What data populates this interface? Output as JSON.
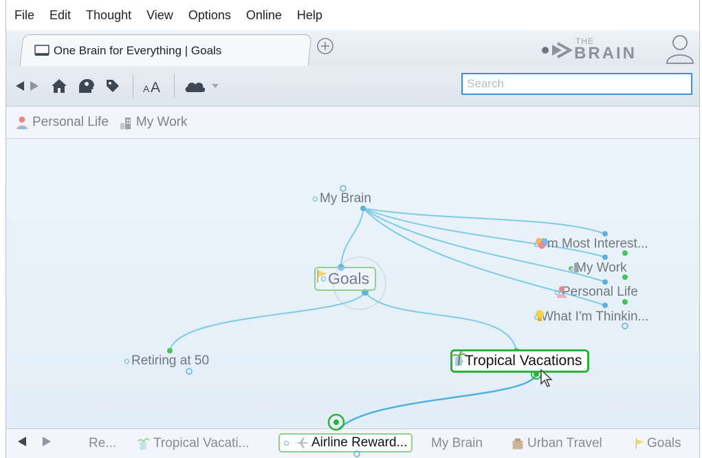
{
  "menu": [
    "File",
    "Edit",
    "Thought",
    "View",
    "Options",
    "Online",
    "Help"
  ],
  "tab": {
    "title": "One Brain for Everything | Goals"
  },
  "brand": {
    "small": "THE",
    "big": "BRAIN"
  },
  "search": {
    "placeholder": "Search",
    "value": ""
  },
  "pins": [
    {
      "label": "Personal Life",
      "icon": "person-icon"
    },
    {
      "label": "My Work",
      "icon": "building-icon"
    }
  ],
  "plex": {
    "parent": "My Brain",
    "central": "Goals",
    "children": [
      "Retiring at 50",
      "Tropical Vacations"
    ],
    "jumps": [
      "I'm Most Interest...",
      "My Work",
      "Personal Life",
      "What I'm Thinkin..."
    ],
    "grandchild": "Airline Reward..."
  },
  "history": [
    {
      "label": "Re..."
    },
    {
      "label": "Tropical Vacati..."
    },
    {
      "label": "Airline Reward...",
      "current": true
    },
    {
      "label": "My Brain"
    },
    {
      "label": "Urban Travel"
    },
    {
      "label": "Goals"
    }
  ],
  "colors": {
    "link": "#7dcbe5",
    "link_dark": "#4fb2da",
    "active_green": "#2bb23a",
    "dot_blue": "#5fb1dc",
    "dot_green": "#46c35a",
    "search_border": "#3a8ee6"
  }
}
